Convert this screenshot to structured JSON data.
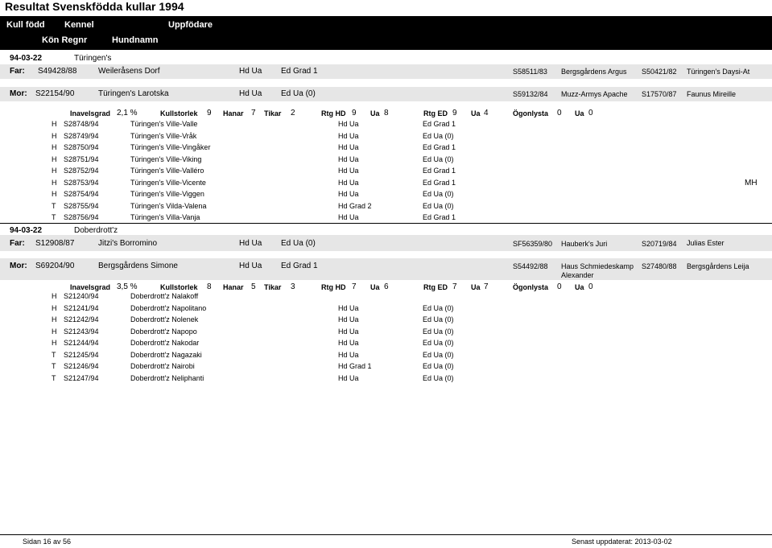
{
  "title": "Resultat Svenskfödda kullar 1994",
  "header": {
    "kull_fodd": "Kull född",
    "kennel": "Kennel",
    "uppfodare": "Uppfödare",
    "kon_regnr": "Kön Regnr",
    "hundnamn": "Hundnamn"
  },
  "kull1": {
    "date": "94-03-22",
    "kennel": "Türingen's",
    "far": {
      "label": "Far:",
      "regnr": "S49428/88",
      "name": "Weileråsens Dorf",
      "hd": "Hd Ua",
      "ed": "Ed Grad 1",
      "f_regnr": "S58511/83",
      "f_name": "Bergsgårdens Argus",
      "m_regnr": "S50421/82",
      "m_name": "Türingen's Daysi-At"
    },
    "mor": {
      "label": "Mor:",
      "regnr": "S22154/90",
      "name": "Türingen's Larotska",
      "hd": "Hd Ua",
      "ed": "Ed Ua (0)",
      "f_regnr": "S59132/84",
      "f_name": "Muzz-Armys Apache",
      "m_regnr": "S17570/87",
      "m_name": "Faunus Mireille"
    },
    "stats": {
      "inavel_label": "Inavelsgrad",
      "inavel": "2,1 %",
      "kull_label": "Kullstorlek",
      "kull": "9",
      "hanar_label": "Hanar",
      "hanar": "7",
      "tikar_label": "Tikar",
      "tikar": "2",
      "rtghd_label": "Rtg HD",
      "rtghd": "9",
      "ua1_label": "Ua",
      "ua1": "8",
      "rtged_label": "Rtg ED",
      "rtged": "9",
      "ua2_label": "Ua",
      "ua2": "4",
      "ogon_label": "Ögonlysta",
      "ogon": "0",
      "ua3_label": "Ua",
      "ua3": "0"
    },
    "puppies": [
      {
        "sex": "H",
        "regnr": "S28748/94",
        "name": "Türingen's Ville-Valle",
        "hd": "Hd Ua",
        "ed": "Ed Grad 1",
        "extra": ""
      },
      {
        "sex": "H",
        "regnr": "S28749/94",
        "name": "Türingen's Ville-Vråk",
        "hd": "Hd Ua",
        "ed": "Ed Ua (0)",
        "extra": ""
      },
      {
        "sex": "H",
        "regnr": "S28750/94",
        "name": "Türingen's Ville-Vingåker",
        "hd": "Hd Ua",
        "ed": "Ed Grad 1",
        "extra": ""
      },
      {
        "sex": "H",
        "regnr": "S28751/94",
        "name": "Türingen's Ville-Viking",
        "hd": "Hd Ua",
        "ed": "Ed Ua (0)",
        "extra": ""
      },
      {
        "sex": "H",
        "regnr": "S28752/94",
        "name": "Türingen's Ville-Valléro",
        "hd": "Hd Ua",
        "ed": "Ed Grad 1",
        "extra": ""
      },
      {
        "sex": "H",
        "regnr": "S28753/94",
        "name": "Türingen's Ville-Vicente",
        "hd": "Hd Ua",
        "ed": "Ed Grad 1",
        "extra": "MH"
      },
      {
        "sex": "H",
        "regnr": "S28754/94",
        "name": "Türingen's Ville-Viggen",
        "hd": "Hd Ua",
        "ed": "Ed Ua (0)",
        "extra": ""
      },
      {
        "sex": "T",
        "regnr": "S28755/94",
        "name": "Türingen's Vilda-Valena",
        "hd": "Hd Grad 2",
        "ed": "Ed Ua (0)",
        "extra": ""
      },
      {
        "sex": "T",
        "regnr": "S28756/94",
        "name": "Türingen's Villa-Vanja",
        "hd": "Hd Ua",
        "ed": "Ed Grad 1",
        "extra": ""
      }
    ]
  },
  "kull2": {
    "date": "94-03-22",
    "kennel": "Doberdrott'z",
    "far": {
      "label": "Far:",
      "regnr": "S12908/87",
      "name": "Jitzi's Borromino",
      "hd": "Hd Ua",
      "ed": "Ed Ua (0)",
      "f_regnr": "SF56359/80",
      "f_name": "Hauberk's Juri",
      "m_regnr": "S20719/84",
      "m_name": "Julias Ester"
    },
    "mor": {
      "label": "Mor:",
      "regnr": "S69204/90",
      "name": "Bergsgårdens Simone",
      "hd": "Hd Ua",
      "ed": "Ed Grad 1",
      "f_regnr": "S54492/88",
      "f_name": "Haus Schmiedeskamp",
      "f_name2": "Alexander",
      "m_regnr": "S27480/88",
      "m_name": "Bergsgårdens Leija"
    },
    "stats": {
      "inavel_label": "Inavelsgrad",
      "inavel": "3,5 %",
      "kull_label": "Kullstorlek",
      "kull": "8",
      "hanar_label": "Hanar",
      "hanar": "5",
      "tikar_label": "Tikar",
      "tikar": "3",
      "rtghd_label": "Rtg HD",
      "rtghd": "7",
      "ua1_label": "Ua",
      "ua1": "6",
      "rtged_label": "Rtg ED",
      "rtged": "7",
      "ua2_label": "Ua",
      "ua2": "7",
      "ogon_label": "Ögonlysta",
      "ogon": "0",
      "ua3_label": "Ua",
      "ua3": "0"
    },
    "puppies": [
      {
        "sex": "H",
        "regnr": "S21240/94",
        "name": "Doberdrott'z Nalakoff",
        "hd": "",
        "ed": "",
        "extra": ""
      },
      {
        "sex": "H",
        "regnr": "S21241/94",
        "name": "Doberdrott'z Napolitano",
        "hd": "Hd Ua",
        "ed": "Ed Ua (0)",
        "extra": ""
      },
      {
        "sex": "H",
        "regnr": "S21242/94",
        "name": "Doberdrott'z Nolenek",
        "hd": "Hd Ua",
        "ed": "Ed Ua (0)",
        "extra": ""
      },
      {
        "sex": "H",
        "regnr": "S21243/94",
        "name": "Doberdrott'z Napopo",
        "hd": "Hd Ua",
        "ed": "Ed Ua (0)",
        "extra": ""
      },
      {
        "sex": "H",
        "regnr": "S21244/94",
        "name": "Doberdrott'z Nakodar",
        "hd": "Hd Ua",
        "ed": "Ed Ua (0)",
        "extra": ""
      },
      {
        "sex": "T",
        "regnr": "S21245/94",
        "name": "Doberdrott'z Nagazaki",
        "hd": "Hd Ua",
        "ed": "Ed Ua (0)",
        "extra": ""
      },
      {
        "sex": "T",
        "regnr": "S21246/94",
        "name": "Doberdrott'z Nairobi",
        "hd": "Hd Grad 1",
        "ed": "Ed Ua (0)",
        "extra": ""
      },
      {
        "sex": "T",
        "regnr": "S21247/94",
        "name": "Doberdrott'z Neliphanti",
        "hd": "Hd Ua",
        "ed": "Ed Ua (0)",
        "extra": ""
      }
    ]
  },
  "footer": {
    "page": "Sidan 16 av 56",
    "updated": "Senast uppdaterat: 2013-03-02"
  }
}
